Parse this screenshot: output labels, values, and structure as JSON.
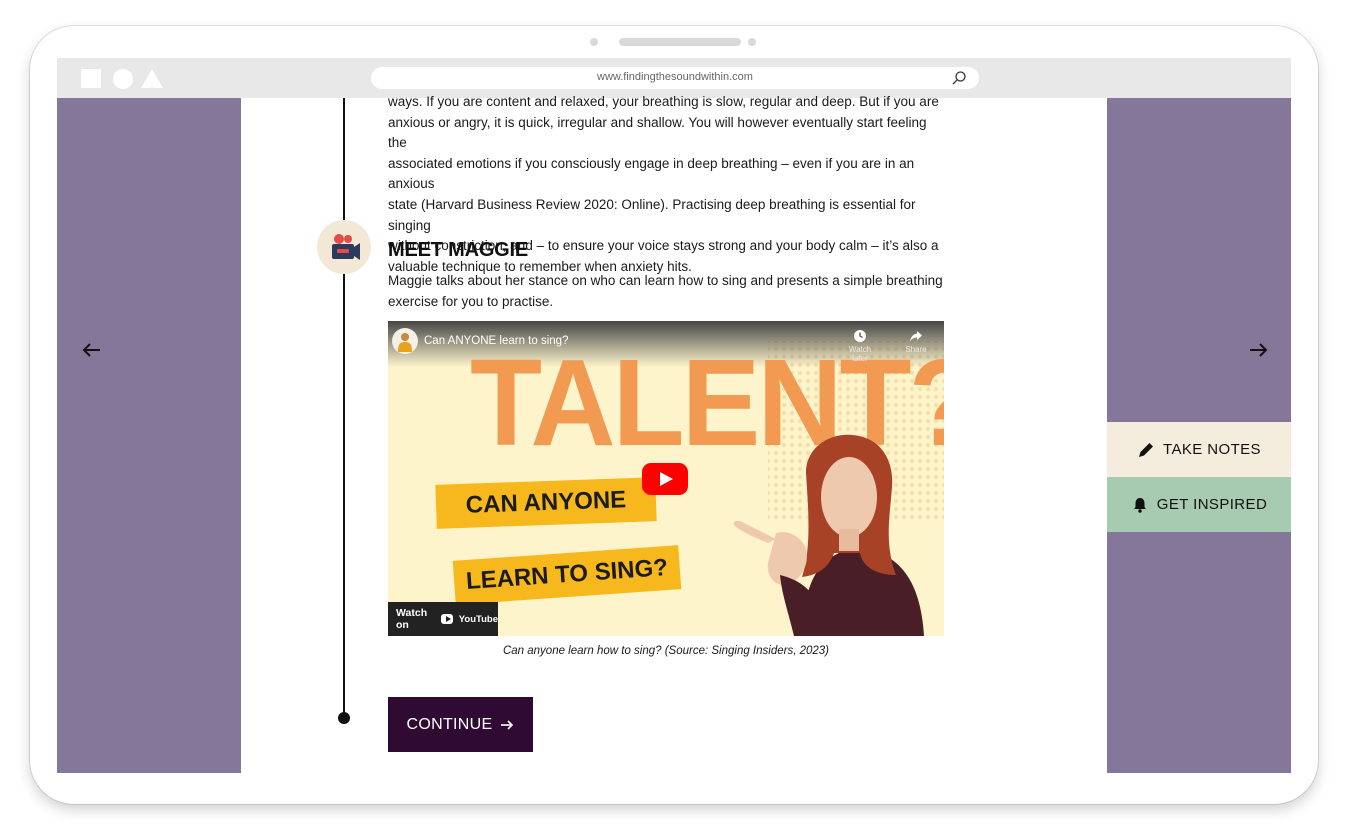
{
  "browser": {
    "url": "www.findingthesoundwithin.com"
  },
  "article": {
    "paragraph_lines": [
      "ways. If you are content and relaxed, your breathing is slow, regular and deep. But if you are",
      "anxious or angry, it is quick, irregular and shallow. You will however eventually start feeling the",
      "associated emotions if you consciously engage in deep breathing – even if you are in an anxious",
      "state (Harvard Business Review 2020: Online). Practising deep breathing is essential for singing",
      "without constriction, and – to ensure your voice stays strong and your body calm – it’s also a",
      "valuable technique to remember when anxiety hits."
    ],
    "section_title": "MEET MAGGIE",
    "section_desc_lines": [
      "Maggie talks about her stance on who can learn how to sing and presents a simple breathing",
      "exercise for you to practise."
    ],
    "caption": "Can anyone learn how to sing? (Source: Singing Insiders, 2023)"
  },
  "video": {
    "title": "Can ANYONE learn to sing?",
    "watch_later": "Watch later",
    "share": "Share",
    "thumbnail_headline": "TALENT?",
    "banner_1": "CAN ANYONE",
    "banner_2": "LEARN TO SING?",
    "watch_on": "Watch on",
    "youtube": "YouTube"
  },
  "actions": {
    "continue": "CONTINUE",
    "take_notes": "TAKE NOTES",
    "get_inspired": "GET INSPIRED"
  },
  "icons": {
    "timeline": "video-camera-icon",
    "prev": "arrow-left-icon",
    "next": "arrow-right-icon",
    "notes": "pen-icon",
    "inspired": "bell-icon",
    "search": "search-icon"
  },
  "colors": {
    "side_panel": "#85779a",
    "continue_bg": "#2f0b33",
    "notes_bg": "#f4ecdd",
    "inspired_bg": "#a6cbb0",
    "timeline_icon_bg": "#f3e8d6"
  }
}
